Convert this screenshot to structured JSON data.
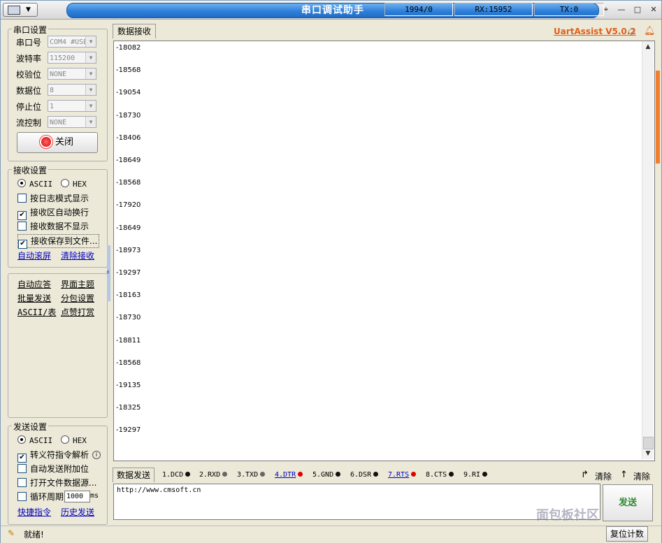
{
  "window": {
    "title": "串口调试助手",
    "brand": "UartAssist V5.0.2"
  },
  "serial": {
    "group_label": "串口设置",
    "fields": [
      {
        "label": "串口号",
        "value": "COM4 #USB"
      },
      {
        "label": "波特率",
        "value": "115200"
      },
      {
        "label": "校验位",
        "value": "NONE"
      },
      {
        "label": "数据位",
        "value": "8"
      },
      {
        "label": "停止位",
        "value": "1"
      },
      {
        "label": "流控制",
        "value": "NONE"
      }
    ],
    "toggle_label": "关闭"
  },
  "receive_settings": {
    "group_label": "接收设置",
    "ascii": "ASCII",
    "hex": "HEX",
    "options": [
      {
        "label": "按日志模式显示",
        "checked": false
      },
      {
        "label": "接收区自动换行",
        "checked": true
      },
      {
        "label": "接收数据不显示",
        "checked": false
      },
      {
        "label": "接收保存到文件...",
        "checked": true
      }
    ],
    "auto_scroll": "自动滚屏",
    "clear": "清除接收"
  },
  "tools": [
    "自动应答",
    "界面主题",
    "批量发送",
    "分包设置",
    "ASCII/表",
    "点赞打赏"
  ],
  "send_settings": {
    "group_label": "发送设置",
    "ascii": "ASCII",
    "hex": "HEX",
    "options": [
      {
        "label": "转义符指令解析",
        "checked": true
      },
      {
        "label": "自动发送附加位",
        "checked": false
      },
      {
        "label": "打开文件数据源...",
        "checked": false
      },
      {
        "label": "循环周期",
        "checked": false
      }
    ],
    "period_value": "1000",
    "period_unit": "ms",
    "shortcut": "快捷指令",
    "history": "历史发送"
  },
  "receive": {
    "tab": "数据接收",
    "lines": [
      "-18082",
      "-18568",
      "-19054",
      "-18730",
      "-18406",
      "-18649",
      "-18568",
      "-17920",
      "-18649",
      "-18973",
      "-19297",
      "-18163",
      "-18730",
      "-18811",
      "-18568",
      "-19135",
      "-18325",
      "-19297"
    ]
  },
  "send": {
    "tab": "数据发送",
    "pins": [
      {
        "label": "1.DCD",
        "color": "#111111",
        "link": false
      },
      {
        "label": "2.RXD",
        "color": "#666666",
        "link": false
      },
      {
        "label": "3.TXD",
        "color": "#666666",
        "link": false
      },
      {
        "label": "4.DTR",
        "color": "#e00000",
        "link": true
      },
      {
        "label": "5.GND",
        "color": "#111111",
        "link": false
      },
      {
        "label": "6.DSR",
        "color": "#111111",
        "link": false
      },
      {
        "label": "7.RTS",
        "color": "#e00000",
        "link": true
      },
      {
        "label": "8.CTS",
        "color": "#111111",
        "link": false
      },
      {
        "label": "9.RI",
        "color": "#111111",
        "link": false
      }
    ],
    "clear1": "清除",
    "clear2": "清除",
    "text": "http://www.cmsoft.cn",
    "button": "发送"
  },
  "status": {
    "ready": "就绪!",
    "counter": "1994/0",
    "rx": "RX:15952",
    "tx": "TX:0",
    "reset": "复位计数"
  },
  "watermark": "面包板社区"
}
